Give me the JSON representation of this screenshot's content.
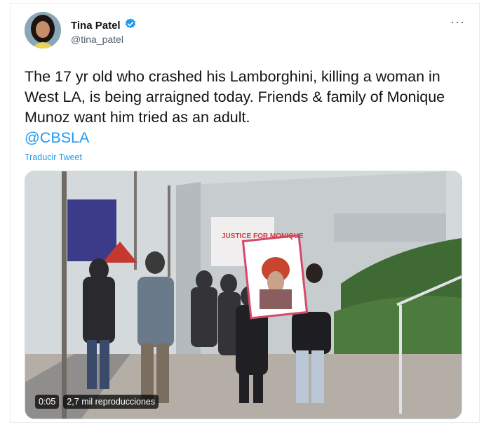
{
  "author": {
    "name": "Tina Patel",
    "handle": "@tina_patel",
    "verified_icon": "verified-badge-icon"
  },
  "more_menu_label": "···",
  "tweet": {
    "text_main": "The 17 yr old who crashed his Lamborghini, killing a woman in West LA, is being arraigned today. Friends & family of Monique Munoz want him tried as an adult.",
    "mention": "@CBSLA",
    "translate_label": "Traducir Tweet"
  },
  "video": {
    "time": "0:05",
    "views": "2,7 mil reproducciones",
    "sign_text": "JUSTICE FOR MONIQUE"
  },
  "colors": {
    "accent": "#1d9bf0",
    "text": "#0f1419",
    "secondary": "#536471"
  }
}
